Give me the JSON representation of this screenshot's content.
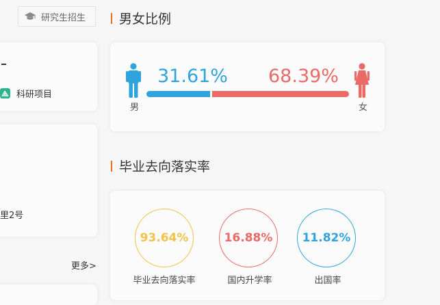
{
  "left": {
    "grad_button_label": "研究生招生",
    "research_label": "科研项目",
    "address_fragment": "里2号",
    "more_label": "更多>"
  },
  "gender": {
    "title": "男女比例",
    "male_label": "男",
    "female_label": "女",
    "male_percent_text": "31.61%",
    "female_percent_text": "68.39%",
    "male_ratio": 0.3161,
    "male_color": "#2ea3dc",
    "female_color": "#ea6a66"
  },
  "employment": {
    "title": "毕业去向落实率",
    "stats": [
      {
        "value": "93.64%",
        "label": "毕业去向落实率",
        "color": "#f3c24b"
      },
      {
        "value": "16.88%",
        "label": "国内升学率",
        "color": "#ea6a66"
      },
      {
        "value": "11.82%",
        "label": "出国率",
        "color": "#2ea3dc"
      }
    ]
  },
  "colors": {
    "accent": "#e8731b",
    "background": "#f6f6f6",
    "card": "#fbfbfb"
  },
  "icons": {
    "grad": "graduation-cap-icon",
    "research": "research-project-icon",
    "male": "male-person-icon",
    "female": "female-person-icon"
  }
}
